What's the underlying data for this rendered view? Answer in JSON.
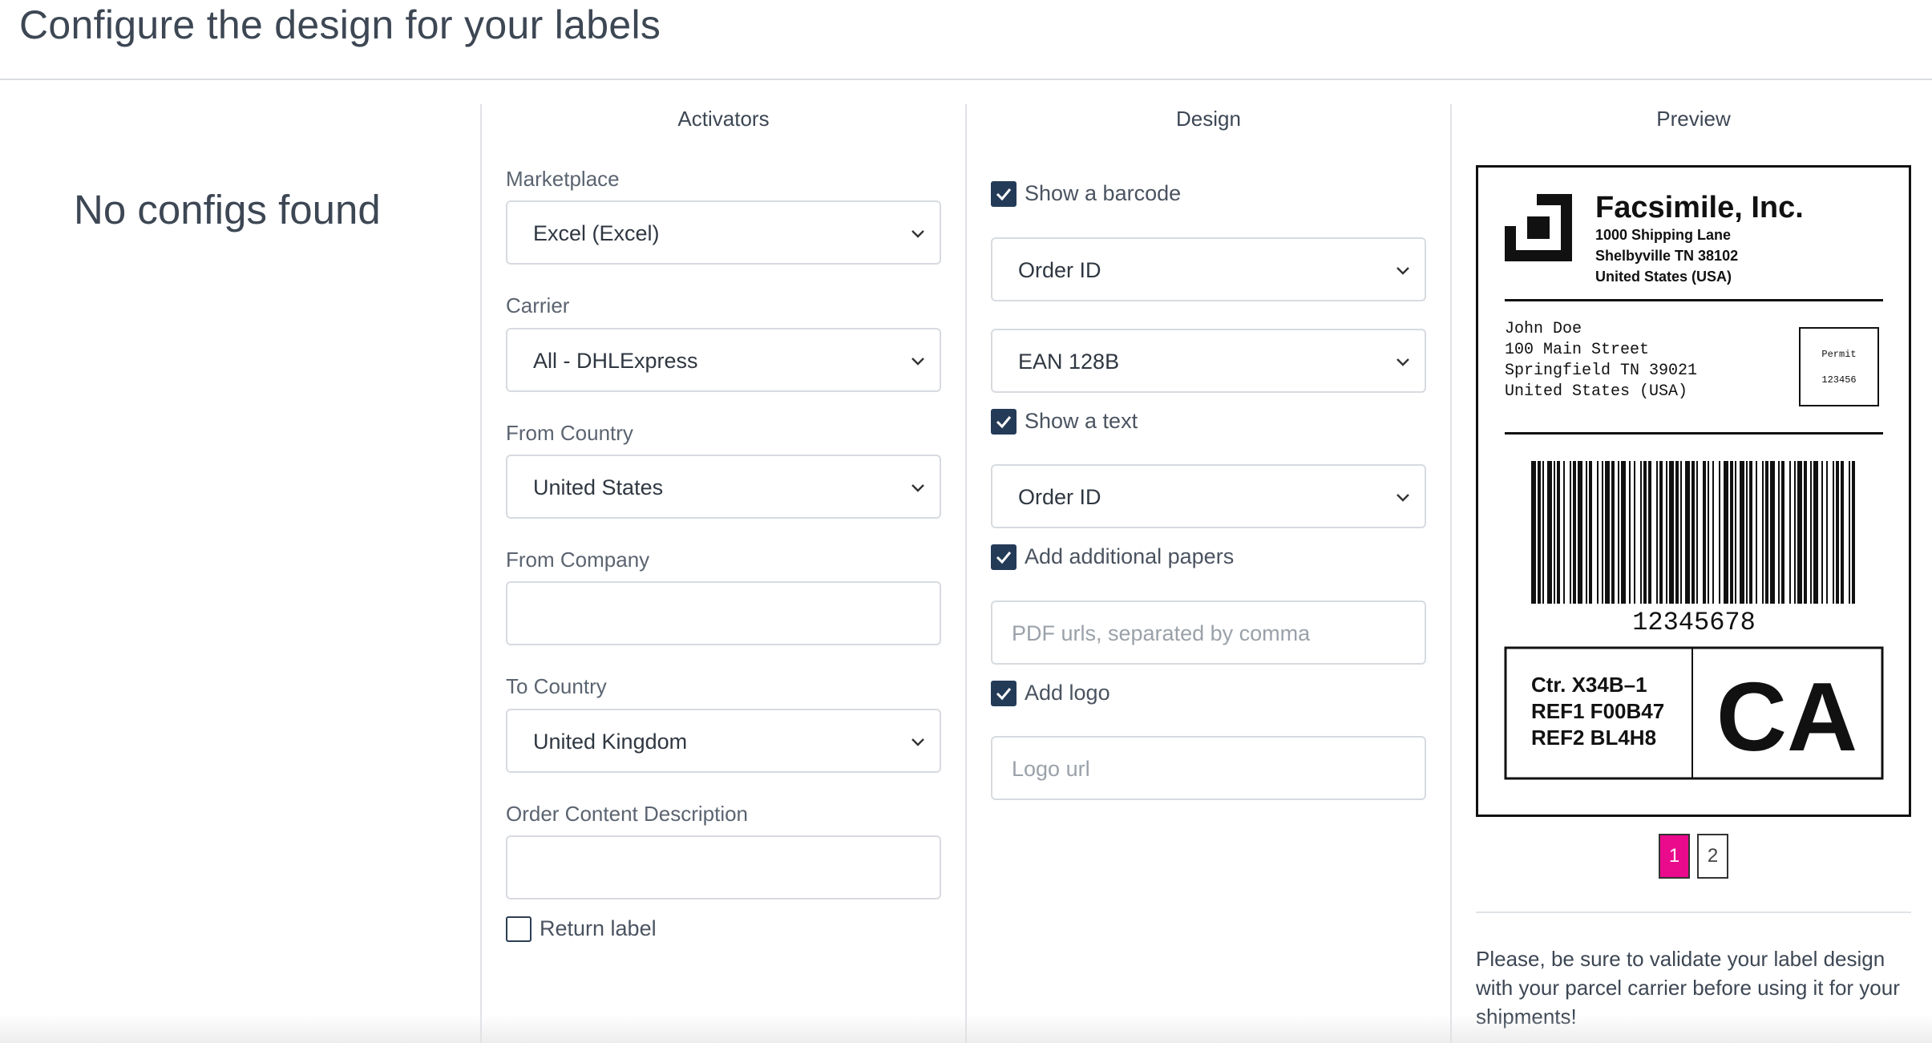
{
  "page": {
    "title": "Configure the design for your labels"
  },
  "sidebar": {
    "empty_text": "No configs found"
  },
  "activators": {
    "heading": "Activators",
    "marketplace": {
      "label": "Marketplace",
      "value": "Excel (Excel)"
    },
    "carrier": {
      "label": "Carrier",
      "value": "All - DHLExpress"
    },
    "from_country": {
      "label": "From Country",
      "value": "United States"
    },
    "from_company": {
      "label": "From Company",
      "value": ""
    },
    "to_country": {
      "label": "To Country",
      "value": "United Kingdom"
    },
    "order_content": {
      "label": "Order Content Description",
      "value": ""
    },
    "return_label": {
      "label": "Return label",
      "checked": false
    }
  },
  "design": {
    "heading": "Design",
    "show_barcode": {
      "label": "Show a barcode",
      "checked": true
    },
    "barcode_field": {
      "value": "Order ID"
    },
    "barcode_type": {
      "value": "EAN 128B"
    },
    "show_text": {
      "label": "Show a text",
      "checked": true
    },
    "text_field": {
      "value": "Order ID"
    },
    "additional_papers": {
      "label": "Add additional papers",
      "checked": true,
      "placeholder": "PDF urls, separated by comma"
    },
    "add_logo": {
      "label": "Add logo",
      "checked": true,
      "placeholder": "Logo url"
    }
  },
  "preview": {
    "heading": "Preview",
    "label": {
      "company": "Facsimile, Inc.",
      "sender_lines": [
        "1000 Shipping Lane",
        "Shelbyville TN 38102",
        "United States (USA)"
      ],
      "recipient_lines": [
        "John Doe",
        "100 Main Street",
        "Springfield TN 39021",
        "United States (USA)"
      ],
      "permit_title": "Permit",
      "permit_number": "123456",
      "barcode_number": "12345678",
      "ref_lines": [
        "Ctr. X34B–1",
        "REF1 F00B47",
        "REF2 BL4H8"
      ],
      "code": "CA"
    },
    "pages": [
      "1",
      "2"
    ],
    "active_page": "1",
    "notice": "Please, be sure to validate your label design with your parcel carrier before using it for your shipments!"
  },
  "colors": {
    "accent": "#ea0a8c",
    "checkbox": "#243b58",
    "text": "#3d4754"
  }
}
